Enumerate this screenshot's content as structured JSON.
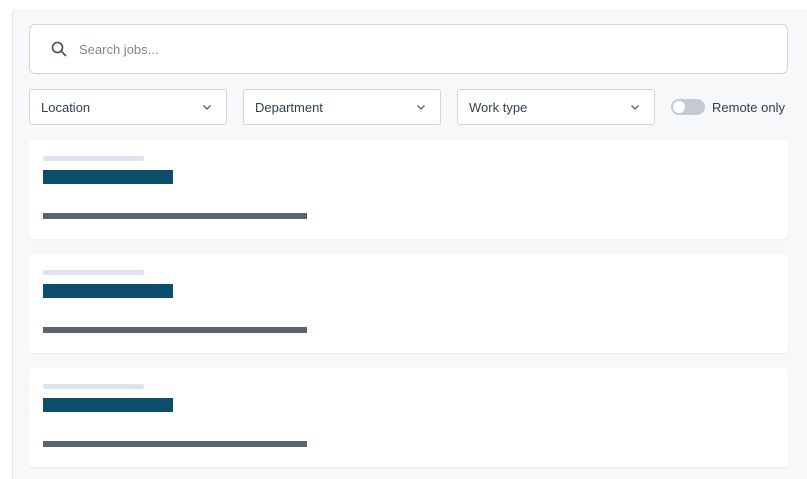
{
  "search": {
    "placeholder": "Search jobs...",
    "value": ""
  },
  "filters": [
    {
      "label": "Location"
    },
    {
      "label": "Department"
    },
    {
      "label": "Work type"
    }
  ],
  "remote_toggle": {
    "label": "Remote only",
    "on": false
  },
  "colors": {
    "accent_title": "#0b4f6c",
    "toggle_off": "#c3cad2"
  },
  "icons": {
    "search": "search-icon",
    "dropdown": "chevron-down-icon"
  },
  "job_cards": [
    {
      "state": "loading"
    },
    {
      "state": "loading"
    },
    {
      "state": "loading"
    }
  ]
}
